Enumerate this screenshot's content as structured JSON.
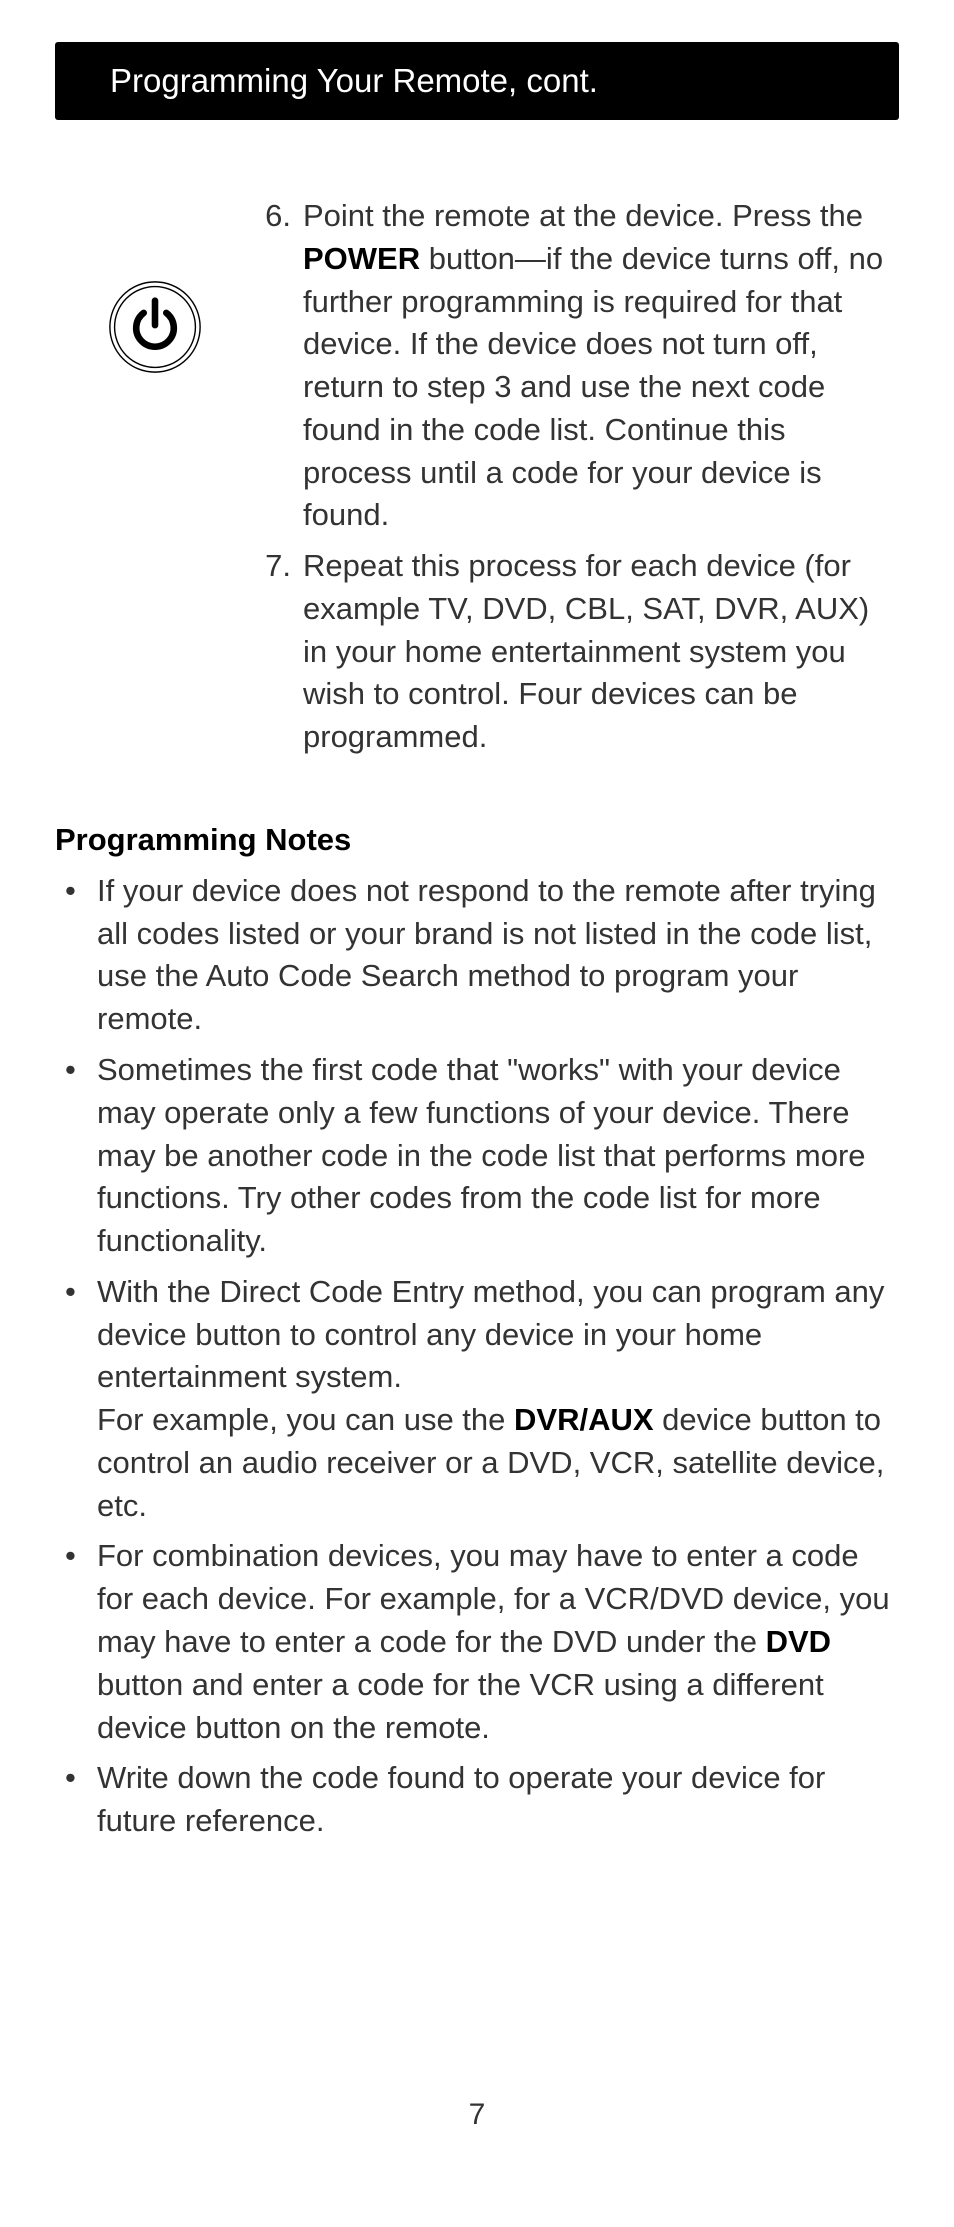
{
  "header": {
    "title": "Programming Your Remote, cont."
  },
  "steps": [
    {
      "number": "6.",
      "text_pre": "Point the remote at the device. Press the ",
      "bold1": "POWER",
      "text_post": " button—if the device turns off, no further programming is required for that device. If the device does not turn off, return to step 3 and use the next code found in the code list. Continue this process until a code for your device is found."
    },
    {
      "number": "7.",
      "text_pre": "Repeat this process for each device (for example TV, DVD, CBL, SAT, DVR, AUX) in your home entertainment system you wish to control. Four devices can be programmed.",
      "bold1": "",
      "text_post": ""
    }
  ],
  "notes": {
    "heading": "Programming Notes",
    "items": [
      {
        "p1": "If your device does not respond to the remote after trying all codes listed or your brand is not listed in the code list, use the Auto Code Search method to program your remote.",
        "b1": "",
        "p2": "",
        "b2": "",
        "p3": ""
      },
      {
        "p1": "Sometimes the first code that \"works\" with your device may operate only a few functions of your device. There may be another code in the code list that performs more functions. Try other codes from the code list for more functionality.",
        "b1": "",
        "p2": "",
        "b2": "",
        "p3": ""
      },
      {
        "p1": "With the Direct Code Entry method, you can program any device button to control any device in your home entertainment system.",
        "br": true,
        "p1b": "For example, you can use the ",
        "b1": "DVR/AUX",
        "p2": " device button to control an audio receiver or a DVD, VCR, satellite device, etc.",
        "b2": "",
        "p3": ""
      },
      {
        "p1": "For combination devices, you may have to enter a code for each device. For example, for a VCR/DVD device, you may have to enter a code for the DVD under the ",
        "b1": "DVD",
        "p2": " button and enter a code for the VCR using a different device button on the remote.",
        "b2": "",
        "p3": ""
      },
      {
        "p1": "Write down the code found to operate your device for future reference.",
        "b1": "",
        "p2": "",
        "b2": "",
        "p3": ""
      }
    ]
  },
  "page_number": "7",
  "bullet": "•"
}
